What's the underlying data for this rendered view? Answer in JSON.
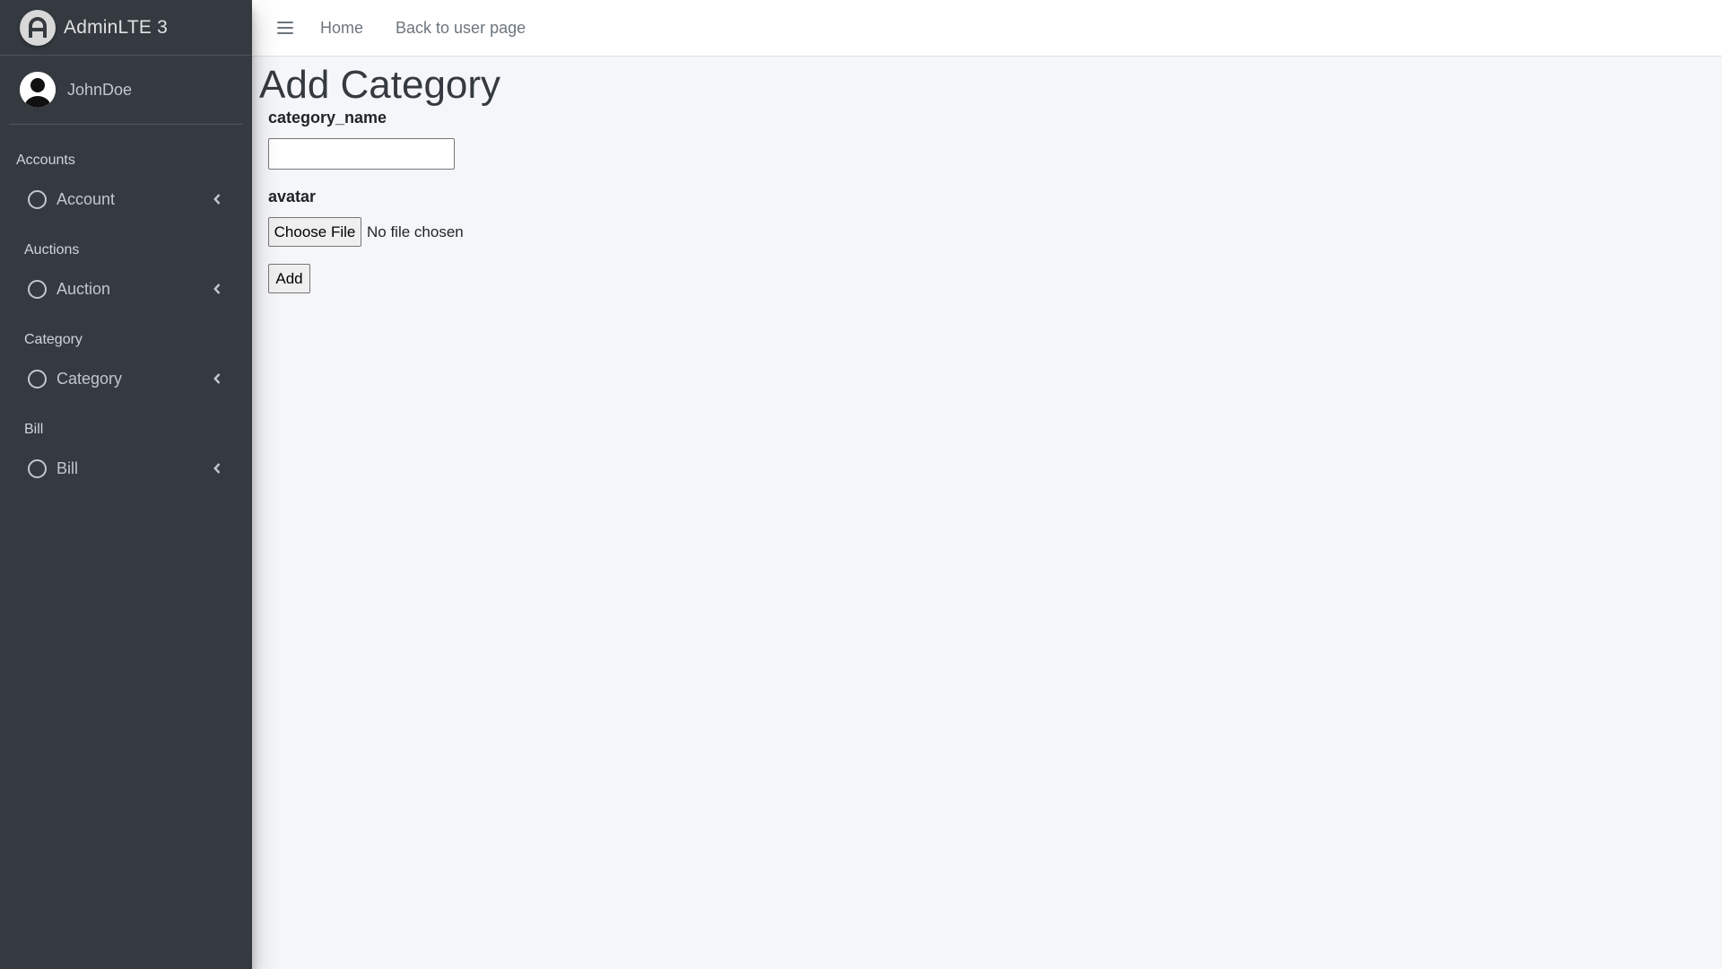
{
  "sidebar": {
    "brand": {
      "text": "AdminLTE 3",
      "icon": "adminlte-logo-icon"
    },
    "user": {
      "name": "JohnDoe",
      "icon": "user-avatar-icon"
    },
    "sections": [
      {
        "header": "Accounts",
        "item": "Account"
      },
      {
        "header": "Auctions",
        "item": "Auction"
      },
      {
        "header": "Category",
        "item": "Category"
      },
      {
        "header": "Bill",
        "item": "Bill"
      }
    ],
    "item_icon": "circle-icon",
    "expand_icon": "chevron-left-icon"
  },
  "navbar": {
    "menu_icon": "hamburger-icon",
    "links": [
      "Home",
      "Back to user page"
    ]
  },
  "main": {
    "title": "Add Category",
    "form": {
      "name_label": "category_name",
      "name_value": "",
      "avatar_label": "avatar",
      "file_button": "Choose File",
      "file_status": "No file chosen",
      "submit": "Add"
    }
  },
  "colors": {
    "sidebar_bg": "#343a40",
    "content_bg": "#f4f6f9",
    "navbar_bg": "#ffffff",
    "sidebar_text": "#c2c7d0"
  }
}
